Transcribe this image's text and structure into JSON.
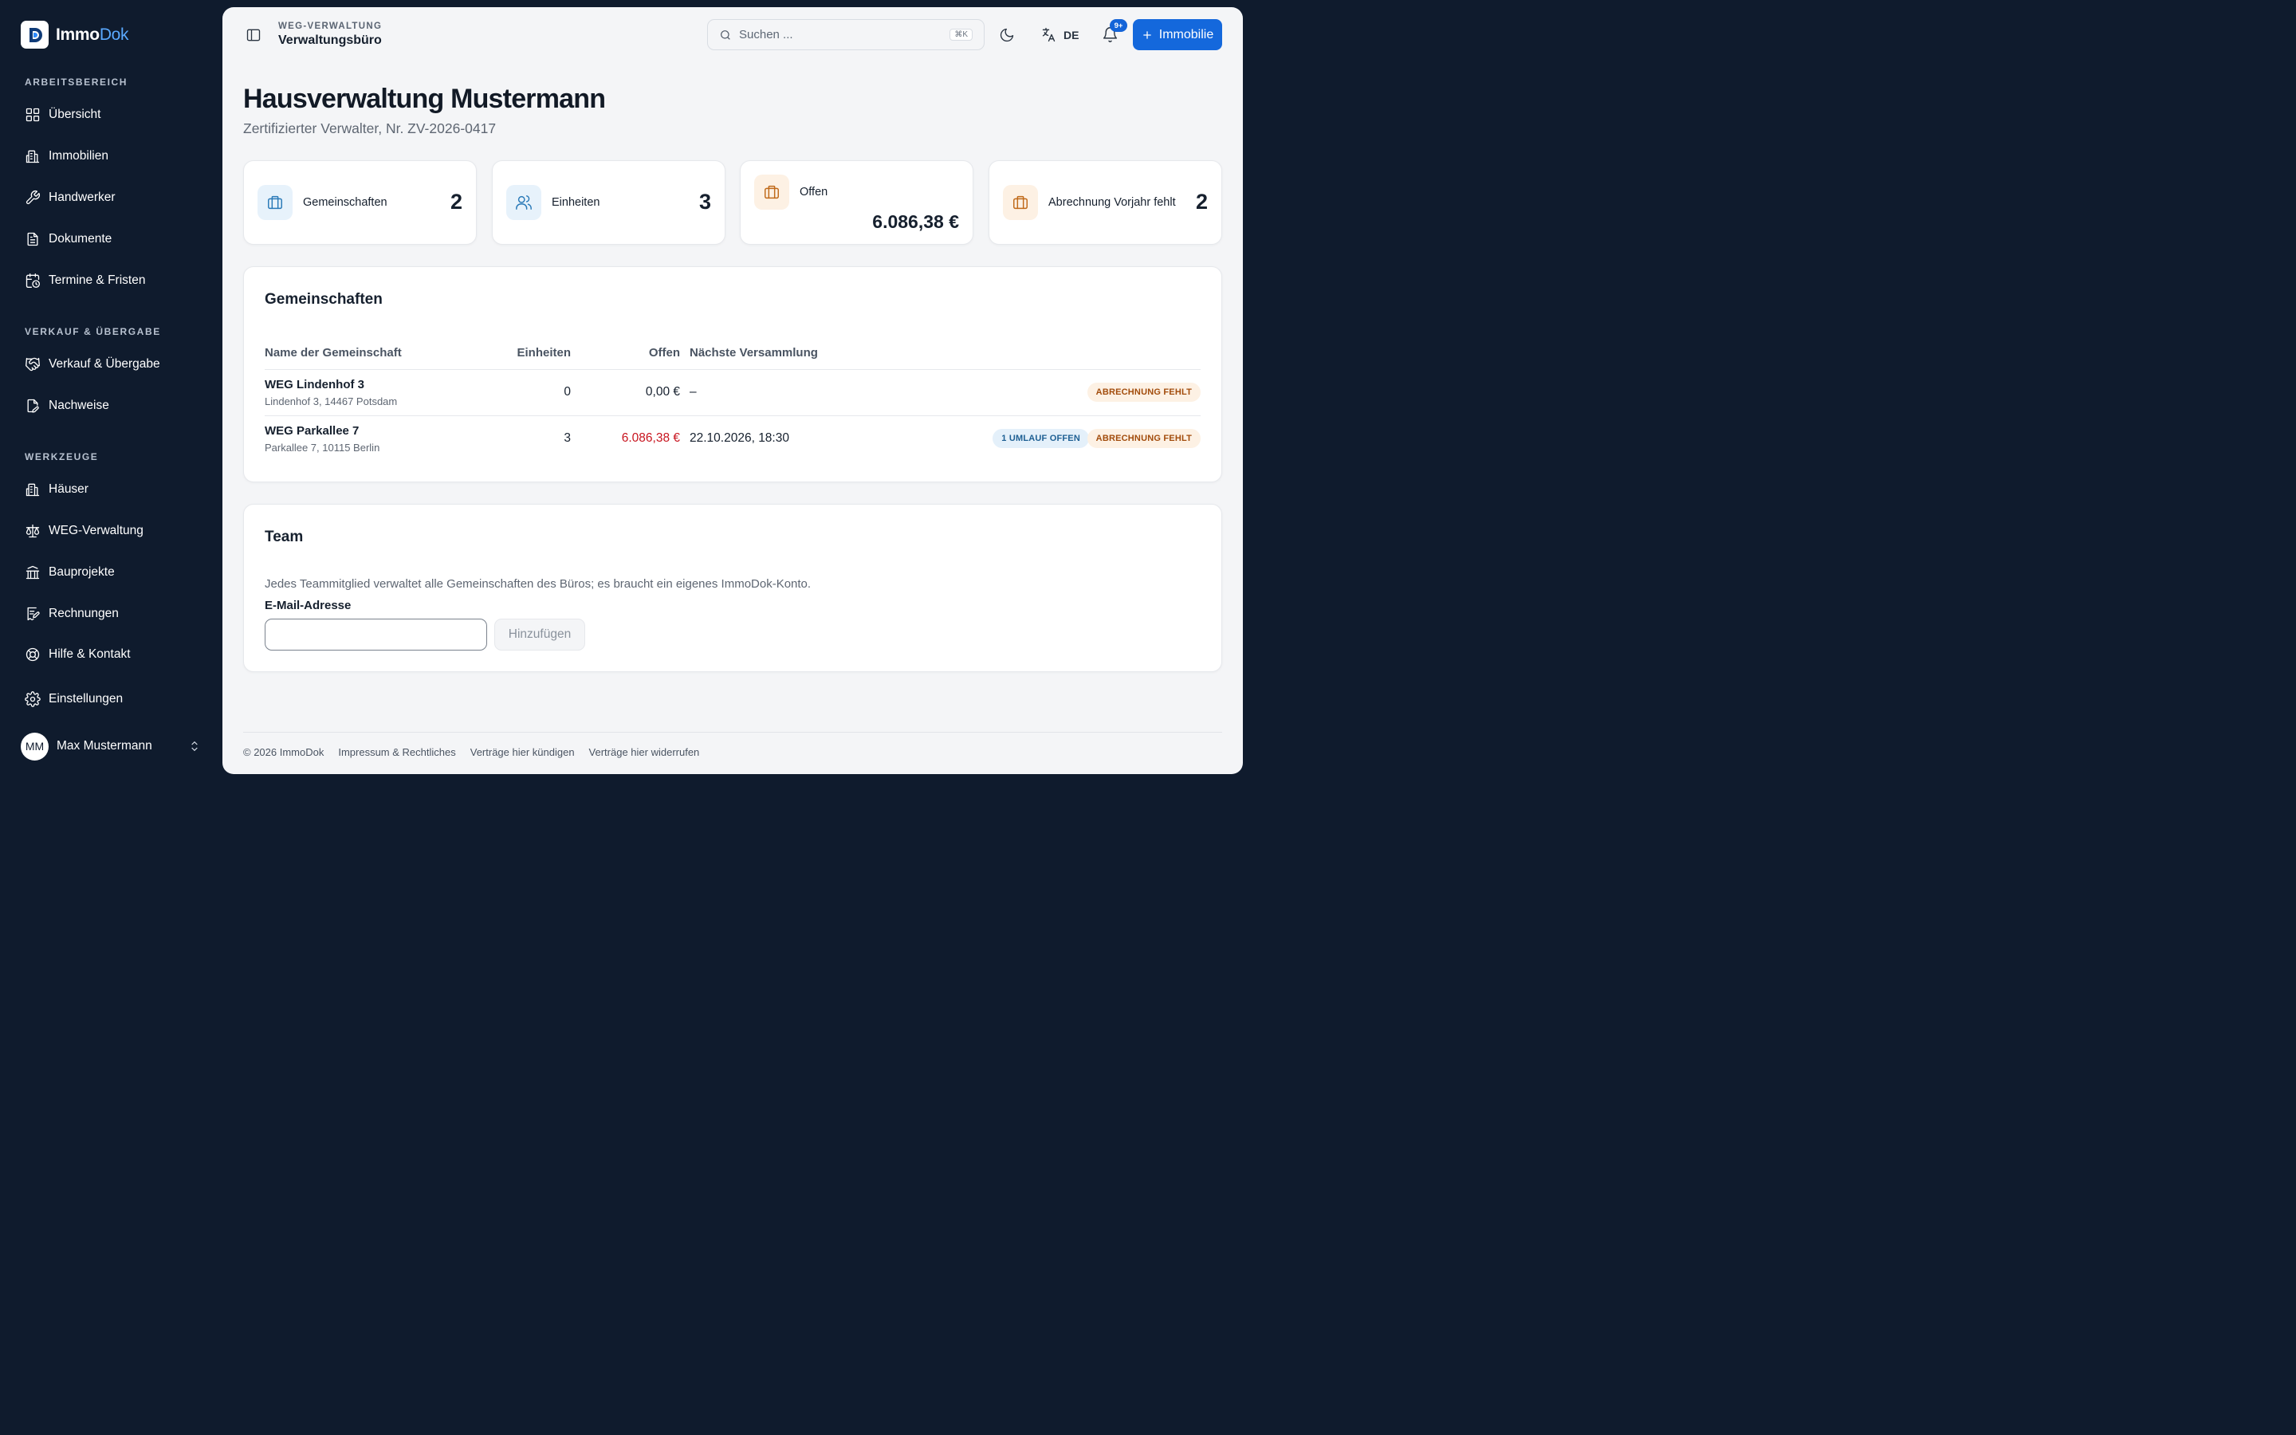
{
  "brand": {
    "name_part1": "Immo",
    "name_part2": "Dok"
  },
  "sidebar": {
    "sections": [
      {
        "label": "ARBEITSBEREICH"
      },
      {
        "label": "VERKAUF & ÜBERGABE"
      },
      {
        "label": "WERKZEUGE"
      }
    ],
    "items": [
      {
        "label": "Übersicht",
        "icon": "grid-icon"
      },
      {
        "label": "Immobilien",
        "icon": "building-icon"
      },
      {
        "label": "Handwerker",
        "icon": "wrench-icon"
      },
      {
        "label": "Dokumente",
        "icon": "document-icon"
      },
      {
        "label": "Termine & Fristen",
        "icon": "calendar-clock-icon"
      },
      {
        "label": "Verkauf & Übergabe",
        "icon": "handshake-icon"
      },
      {
        "label": "Nachweise",
        "icon": "file-edit-icon"
      },
      {
        "label": "Häuser",
        "icon": "building-icon"
      },
      {
        "label": "WEG-Verwaltung",
        "icon": "scale-icon"
      },
      {
        "label": "Bauprojekte",
        "icon": "landmark-icon"
      },
      {
        "label": "Rechnungen",
        "icon": "receipt-edit-icon"
      },
      {
        "label": "Hilfe & Kontakt",
        "icon": "lifebuoy-icon"
      },
      {
        "label": "Einstellungen",
        "icon": "gear-icon"
      }
    ],
    "user": {
      "initials": "MM",
      "name": "Max Mustermann"
    }
  },
  "topbar": {
    "crumb_small": "WEG-VERWALTUNG",
    "crumb_big": "Verwaltungsbüro",
    "search_placeholder": "Suchen ...",
    "search_shortcut": "⌘K",
    "language": "DE",
    "notifications_badge": "9+",
    "primary_button": "Immobilie"
  },
  "page": {
    "title": "Hausverwaltung Mustermann",
    "subtitle": "Zertifizierter Verwalter, Nr. ZV-2026-0417"
  },
  "stats": [
    {
      "label": "Gemeinschaften",
      "value": "2",
      "icon": "briefcase-icon",
      "tone": "blue"
    },
    {
      "label": "Einheiten",
      "value": "3",
      "icon": "users-icon",
      "tone": "blue"
    },
    {
      "label": "Offen",
      "value": "6.086,38 €",
      "icon": "briefcase-icon",
      "tone": "orange"
    },
    {
      "label": "Abrechnung Vorjahr fehlt",
      "value": "2",
      "icon": "briefcase-icon",
      "tone": "orange"
    }
  ],
  "communities": {
    "title": "Gemeinschaften",
    "columns": [
      "Name der Gemeinschaft",
      "Einheiten",
      "Offen",
      "Nächste Versammlung"
    ],
    "rows": [
      {
        "name": "WEG Lindenhof 3",
        "address": "Lindenhof 3, 14467 Potsdam",
        "units": "0",
        "open": "0,00 €",
        "next_meeting": "–",
        "badges": [
          "ABRECHNUNG FEHLT"
        ]
      },
      {
        "name": "WEG Parkallee 7",
        "address": "Parkallee 7, 10115 Berlin",
        "units": "3",
        "open": "6.086,38 €",
        "next_meeting": "22.10.2026, 18:30",
        "badges": [
          "1 UMLAUF OFFEN",
          "ABRECHNUNG FEHLT"
        ]
      }
    ]
  },
  "team": {
    "title": "Team",
    "description": "Jedes Teammitglied verwaltet alle Gemeinschaften des Büros; es braucht ein eigenes ImmoDok-Konto.",
    "email_label": "E-Mail-Adresse",
    "email_value": "",
    "add_button": "Hinzufügen"
  },
  "footer": {
    "copyright": "© 2026 ImmoDok",
    "links": [
      "Impressum & Rechtliches",
      "Verträge hier kündigen",
      "Verträge hier widerrufen"
    ]
  },
  "colors": {
    "sidebar_bg": "#0f1b2d",
    "accent": "#1468dc",
    "negative": "#c8141e",
    "badge_orange": "#a24c0c",
    "badge_blue": "#1d5f93"
  }
}
